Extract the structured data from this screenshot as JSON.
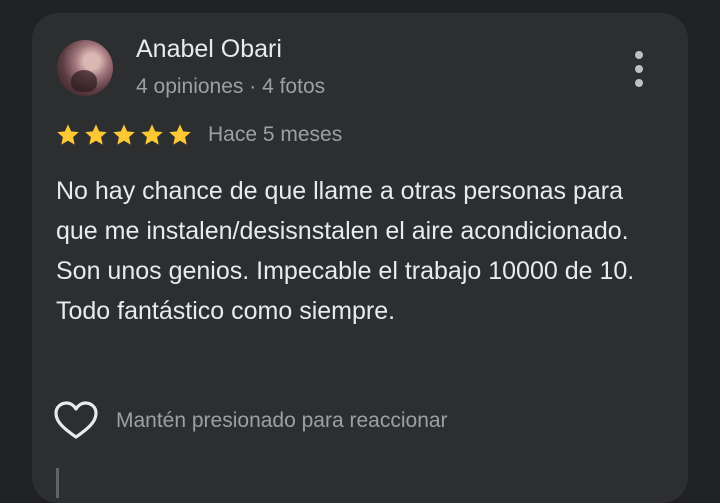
{
  "review": {
    "author_name": "Anabel Obari",
    "author_meta": "4 opiniones · 4 fotos",
    "rating": 5,
    "rating_max": 5,
    "time_ago": "Hace 5 meses",
    "text": "No hay chance de que llame a otras personas para que me instalen/desisnstalen el aire acondicionado. Son unos genios. Impecable el trabajo 10000 de 10. Todo fantástico como siempre.",
    "reaction_prompt": "Mantén presionado para reaccionar"
  },
  "icons": {
    "star": "star-icon",
    "menu": "more-vert-icon",
    "reaction": "heart-outline-icon"
  },
  "colors": {
    "background": "#202124",
    "card": "#2d2e30",
    "star": "#fcc934",
    "primary_text": "#e8eaed",
    "secondary_text": "#9aa0a6"
  }
}
